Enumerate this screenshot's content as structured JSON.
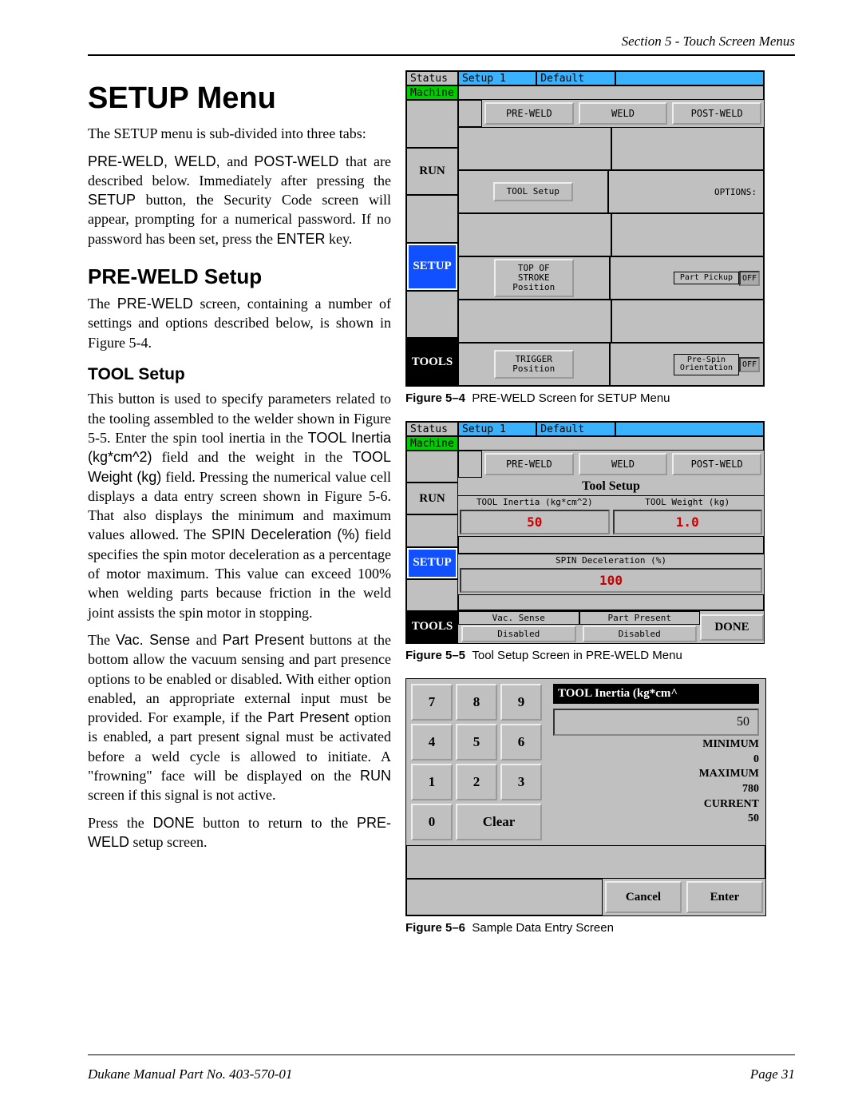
{
  "header": {
    "section": "Section 5 - Touch Screen Menus"
  },
  "text": {
    "h1": "SETUP Menu",
    "p1": "The SETUP menu is sub-divided into three tabs:",
    "p2a": "PRE-WELD, WELD, ",
    "p2b": "and ",
    "p2c": "POST-WELD ",
    "p2d": "that are described below. Immediately after pressing the ",
    "p2e": "SETUP",
    "p2f": " button, the Security Code screen will appear, prompting for a numerical password. If no password has been set, press the ",
    "p2g": "ENTER",
    "p2h": " key.",
    "h2": "PRE-WELD Setup",
    "p3a": "The ",
    "p3b": "PRE-WELD",
    "p3c": " screen, containing a number of settings and options described below, is shown in Figure 5-4.",
    "h3": "TOOL Setup",
    "p4a": "This button is used to specify parameters related to the tooling assembled to the welder shown in Figure 5-5. Enter the spin tool inertia in the ",
    "p4b": "TOOL Inertia (kg*cm^2)",
    "p4c": " field and the weight in the ",
    "p4d": "TOOL Weight (kg)",
    "p4e": " field. Pressing the numerical value cell displays a data entry screen shown in Figure 5-6. That also displays the minimum and maximum values allowed. The ",
    "p4f": "SPIN Deceleration (%)",
    "p4g": " field specifies the spin motor deceleration as a percentage of motor maximum.  This value can exceed 100% when welding parts because friction in the weld joint assists the spin motor in stopping.",
    "p5a": "The ",
    "p5b": "Vac. Sense ",
    "p5c": "and ",
    "p5d": "Part Present",
    "p5e": " buttons at the bottom allow the vacuum sensing and part presence options to be enabled or disabled.  With either option enabled, an appropriate external input must be provided.  For example, if the ",
    "p5f": "Part Present",
    "p5g": " option is enabled, a part present signal must be activated before a weld cycle is allowed to initiate.  A \"frowning\" face will be displayed on the ",
    "p5h": "RUN",
    "p5i": " screen if this signal is not active.",
    "p6a": "Press the ",
    "p6b": "DONE",
    "p6c": " button to return to the ",
    "p6d": "PRE-WELD",
    "p6e": " setup screen."
  },
  "fig4": {
    "caption_b": "Figure 5–4",
    "caption": "PRE-WELD Screen for SETUP Menu",
    "status": "Status",
    "machine": "Machine",
    "setup1": "Setup 1",
    "default": "Default",
    "tabs": {
      "pre": "PRE-WELD",
      "weld": "WELD",
      "post": "POST-WELD"
    },
    "side": {
      "run": "RUN",
      "setup": "SETUP",
      "tools": "TOOLS"
    },
    "btn_tool": "TOOL Setup",
    "btn_tos": "TOP OF\nSTROKE\nPosition",
    "btn_trig": "TRIGGER\nPosition",
    "options": "OPTIONS:",
    "opt1": "Part Pickup",
    "opt2": "Pre-Spin\nOrientation",
    "off": "OFF"
  },
  "fig5": {
    "caption_b": "Figure 5–5",
    "caption": "Tool Setup Screen in PRE-WELD Menu",
    "title": "Tool Setup",
    "hdr_inertia": "TOOL Inertia (kg*cm^2)",
    "hdr_weight": "TOOL Weight (kg)",
    "val_inertia": "50",
    "val_weight": "1.0",
    "hdr_decel": "SPIN Deceleration (%)",
    "val_decel": "100",
    "vac": "Vac. Sense",
    "part": "Part Present",
    "disabled": "Disabled",
    "done": "DONE"
  },
  "fig6": {
    "caption_b": "Figure 5–6",
    "caption": "Sample Data Entry Screen",
    "keys": {
      "k7": "7",
      "k8": "8",
      "k9": "9",
      "k4": "4",
      "k5": "5",
      "k6": "6",
      "k1": "1",
      "k2": "2",
      "k3": "3",
      "k0": "0",
      "clear": "Clear"
    },
    "title": "TOOL Inertia (kg*cm^",
    "value": "50",
    "min_l": "MINIMUM",
    "min_v": "0",
    "max_l": "MAXIMUM",
    "max_v": "780",
    "cur_l": "CURRENT",
    "cur_v": "50",
    "cancel": "Cancel",
    "enter": "Enter"
  },
  "footer": {
    "left": "Dukane Manual Part No. 403-570-01",
    "right": "Page   31"
  }
}
